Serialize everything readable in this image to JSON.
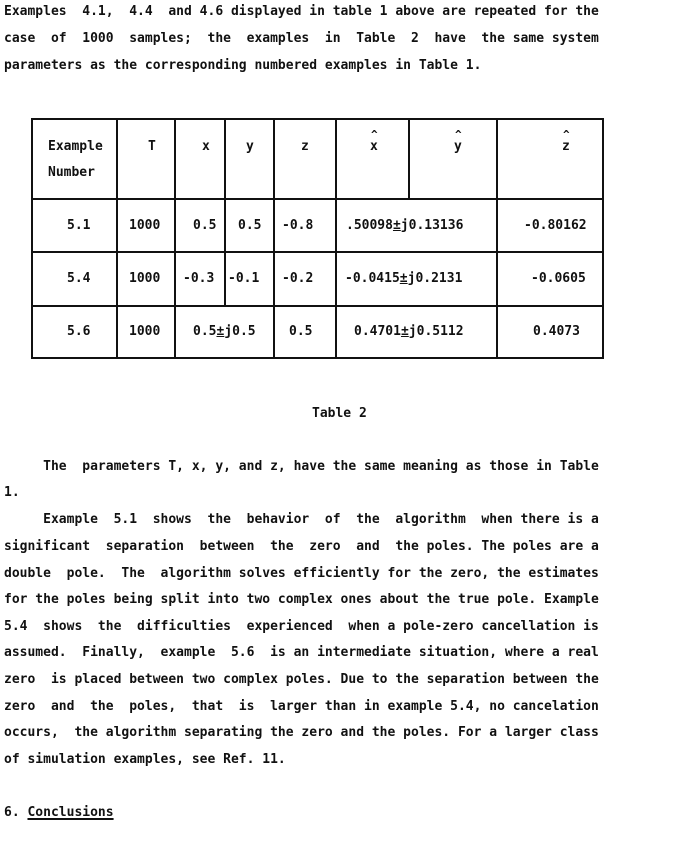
{
  "intro": {
    "lines": [
      "Examples  4.1,  4.4  and 4.6 displayed in table 1 above are repeated for the",
      "case  of  1000  samples;  the  examples  in  Table  2  have  the same system",
      "parameters as the corresponding numbered examples in Table 1."
    ]
  },
  "table": {
    "caption": "Table 2",
    "headers": {
      "example_number_line1": "Example",
      "example_number_line2": "Number",
      "T": "T",
      "x": "x",
      "y": "y",
      "z": "z",
      "x_hat": "x",
      "y_hat": "y",
      "z_hat": "z",
      "hat_symbol": "^"
    },
    "rows": [
      {
        "example": "5.1",
        "T": "1000",
        "x": "0.5",
        "y": "0.5",
        "xy_merged": null,
        "z": "-0.8",
        "xy_hat": ".50098±j0.13136",
        "xy_hat_pre": ".50098",
        "xy_hat_pm": "±",
        "xy_hat_post": "j0.13136",
        "z_hat": "-0.80162"
      },
      {
        "example": "5.4",
        "T": "1000",
        "x": "-0.3",
        "y": "-0.1",
        "xy_merged": null,
        "z": "-0.2",
        "xy_hat": "-0.0415±j0.2131",
        "xy_hat_pre": "-0.0415",
        "xy_hat_pm": "±",
        "xy_hat_post": "j0.2131",
        "z_hat": "-0.0605"
      },
      {
        "example": "5.6",
        "T": "1000",
        "x": null,
        "y": null,
        "xy_merged": "0.5±j0.5",
        "xy_merged_pre": "0.5",
        "xy_merged_pm": "±",
        "xy_merged_post": "j0.5",
        "z": "0.5",
        "xy_hat": "0.4701±j0.5112",
        "xy_hat_pre": "0.4701",
        "xy_hat_pm": "±",
        "xy_hat_post": "j0.5112",
        "z_hat": "0.4073"
      }
    ]
  },
  "body": {
    "para1": [
      "     The  parameters T, x, y, and z, have the same meaning as those in Table",
      "1."
    ],
    "para2": [
      "     Example  5.1  shows  the  behavior  of  the  algorithm  when there is a",
      "significant  separation  between  the  zero  and  the poles. The poles are a",
      "double  pole.  The  algorithm solves efficiently for the zero, the estimates",
      "for the poles being split into two complex ones about the true pole. Example",
      "5.4  shows  the  difficulties  experienced  when a pole-zero cancellation is",
      "assumed.  Finally,  example  5.6  is an intermediate situation, where a real",
      "zero  is placed between two complex poles. Due to the separation between the",
      "zero  and  the  poles,  that  is  larger than in example 5.4, no cancelation",
      "occurs,  the algorithm separating the zero and the poles. For a larger class",
      "of simulation examples, see Ref. 11."
    ]
  },
  "section": {
    "number": "6.",
    "title": "Conclusions"
  }
}
